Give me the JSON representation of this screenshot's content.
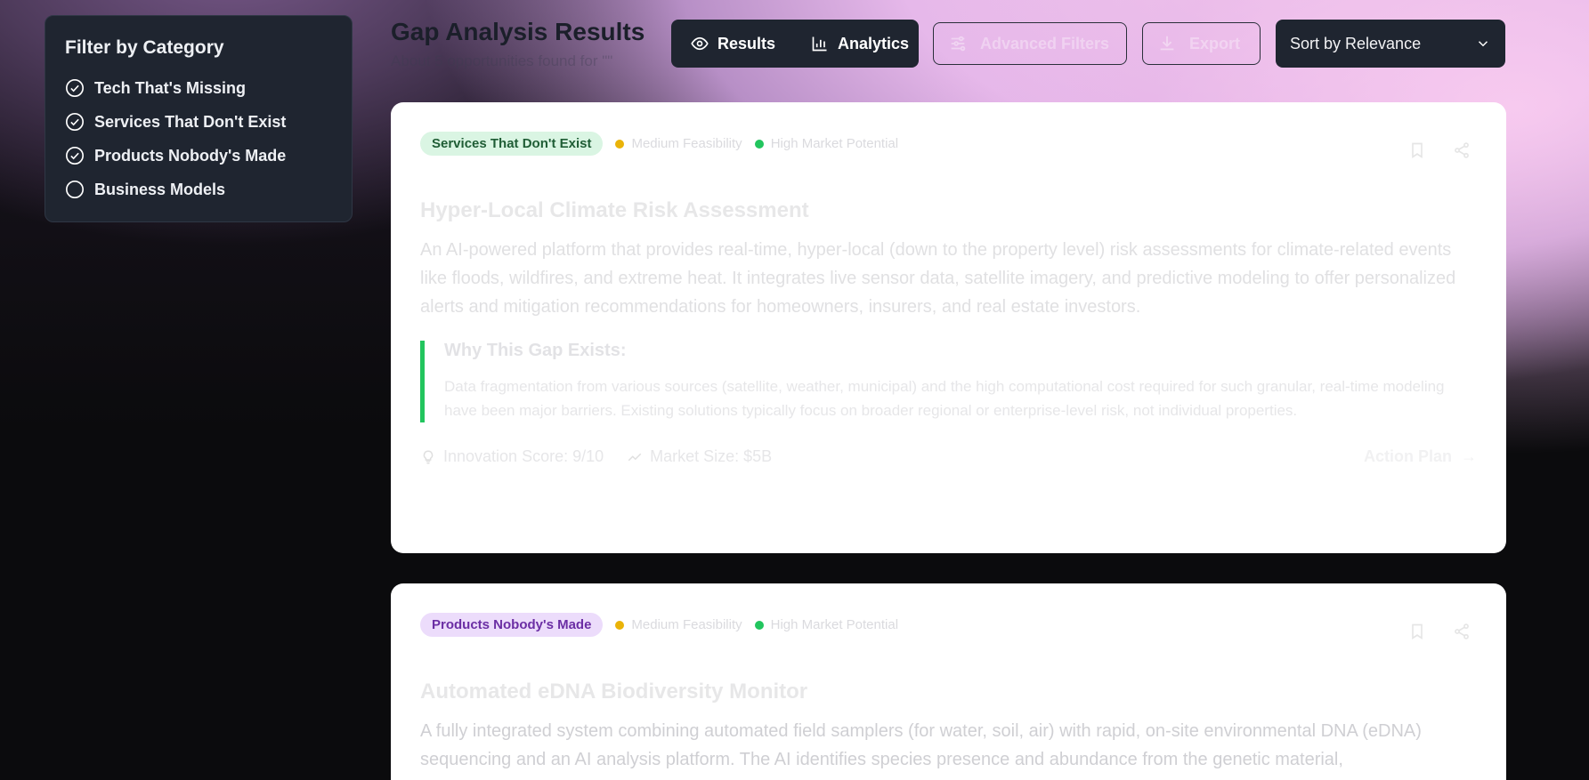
{
  "sidebar": {
    "title": "Filter by Category",
    "categories": [
      {
        "label": "Tech That's Missing",
        "checked": true
      },
      {
        "label": "Services That Don't Exist",
        "checked": true
      },
      {
        "label": "Products Nobody's Made",
        "checked": true
      },
      {
        "label": "Business Models",
        "checked": false
      }
    ]
  },
  "header": {
    "title": "Gap Analysis Results",
    "subtitle": "About 5 opportunities found for \"\"",
    "tabs": {
      "results": "Results",
      "analytics": "Analytics"
    },
    "advanced_filters": "Advanced Filters",
    "export": "Export",
    "sort": "Sort by Relevance"
  },
  "cards": [
    {
      "tag": "Services That Don't Exist",
      "feasibility": "Medium Feasibility",
      "market": "High Market Potential",
      "title": "Hyper-Local Climate Risk Assessment",
      "description": "An AI-powered platform that provides real-time, hyper-local (down to the property level) risk assessments for climate-related events like floods, wildfires, and extreme heat. It integrates live sensor data, satellite imagery, and predictive modeling to offer personalized alerts and mitigation recommendations for homeowners, insurers, and real estate investors.",
      "why_title": "Why This Gap Exists:",
      "why_text": "Data fragmentation from various sources (satellite, weather, municipal) and the high computational cost required for such granular, real-time modeling have been major barriers. Existing solutions typically focus on broader regional or enterprise-level risk, not individual properties.",
      "innovation": "Innovation Score: 9/10",
      "market_size": "Market Size: $5B",
      "action": "Action Plan"
    },
    {
      "tag": "Products Nobody's Made",
      "feasibility": "Medium Feasibility",
      "market": "High Market Potential",
      "title": "Automated eDNA Biodiversity Monitor",
      "description": "A fully integrated system combining automated field samplers (for water, soil, air) with rapid, on-site environmental DNA (eDNA) sequencing and an AI analysis platform. The AI identifies species presence and abundance from the genetic material,"
    }
  ]
}
